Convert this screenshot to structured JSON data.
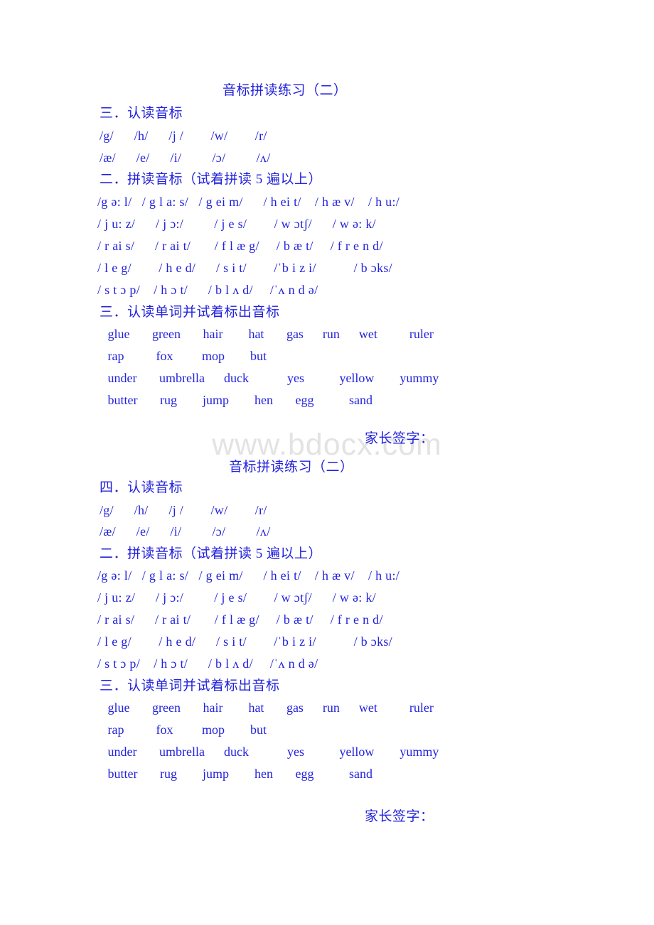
{
  "watermark": {
    "text": "www.bdocx.com"
  },
  "document": {
    "title": "音标拼读练习（二）"
  },
  "blocks": [
    {
      "title": "音标拼读练习（二）",
      "recognize_heading": "三．认读音标",
      "symbol_rows": [
        "/g/      /h/      /j /        /w/        /r/",
        "/æ/      /e/      /i/         /ɔ/         /ʌ/"
      ],
      "spell_heading": "二．拼读音标（试着拼读 5 遍以上）",
      "ipa_rows": [
        "/g ə: l/   / g l a: s/   / g ei m/      / h ei t/    / h æ v/    / h u:/",
        "/ j u: z/      / j ɔ:/         / j e s/        / w ɔtʃ/      / w ə: k/",
        "/ r ai s/      / r ai t/       / f l æ g/     / b æ t/     / f r e n d/",
        "/ l e g/        / h e d/      / s i t/        /ˈb i z i/           / b ɔks/",
        "/ s t ɔ p/    / h ɔ t/      / b l ʌ d/     /ˈʌ n d ə/"
      ],
      "words_heading": "三．认读单词并试着标出音标",
      "word_rows": [
        " glue       green       hair        hat       gas      run      wet          ruler",
        " rap          fox         mop        but",
        " under       umbrella      duck            yes           yellow        yummy",
        " butter       rug        jump        hen       egg           sand"
      ],
      "signature": "家长签字："
    },
    {
      "title": "音标拼读练习（二）",
      "recognize_heading": "四．认读音标",
      "symbol_rows": [
        "/g/      /h/      /j /        /w/        /r/",
        "/æ/      /e/      /i/         /ɔ/         /ʌ/"
      ],
      "spell_heading": "二．拼读音标（试着拼读 5 遍以上）",
      "ipa_rows": [
        "/g ə: l/   / g l a: s/   / g ei m/      / h ei t/    / h æ v/    / h u:/",
        "/ j u: z/      / j ɔ:/         / j e s/        / w ɔtʃ/      / w ə: k/",
        "/ r ai s/      / r ai t/       / f l æ g/     / b æ t/     / f r e n d/",
        "/ l e g/        / h e d/      / s i t/        /ˈb i z i/           / b ɔks/",
        "/ s t ɔ p/    / h ɔ t/      / b l ʌ d/     /ˈʌ n d ə/"
      ],
      "words_heading": "三．认读单词并试着标出音标",
      "word_rows": [
        " glue       green       hair        hat       gas      run      wet          ruler",
        " rap          fox         mop        but",
        " under       umbrella      duck            yes           yellow        yummy",
        " butter       rug        jump        hen       egg           sand"
      ],
      "signature": "家长签字："
    }
  ],
  "colors": {
    "text": "#2222dd",
    "watermark": "#e3e3e3",
    "background": "#ffffff"
  }
}
